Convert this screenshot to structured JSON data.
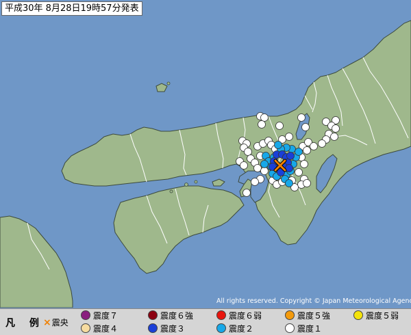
{
  "title": "平成30年 8月28日19時57分発表",
  "copyright": "All rights reserved. Copyright © Japan Meteorological Agency",
  "legend": {
    "heading": "凡 例",
    "epicenter": {
      "symbol": "×",
      "label": "震央",
      "color": "#f08000"
    },
    "items": [
      {
        "label": "震度７",
        "color": "#8a1f7f"
      },
      {
        "label": "震度６強",
        "color": "#8b0010"
      },
      {
        "label": "震度６弱",
        "color": "#e8150e"
      },
      {
        "label": "震度５強",
        "color": "#f39a0c"
      },
      {
        "label": "震度５弱",
        "color": "#f4e30b"
      },
      {
        "label": "震度４",
        "color": "#f6dca0"
      },
      {
        "label": "震度３",
        "color": "#1a3fd8"
      },
      {
        "label": "震度２",
        "color": "#17a8e8"
      },
      {
        "label": "震度１",
        "color": "#ffffff"
      }
    ]
  },
  "colors": {
    "sea": "#6f97c7",
    "land": "#9fb88c",
    "border": "#ffffff",
    "coast": "#3c4a3c"
  }
}
